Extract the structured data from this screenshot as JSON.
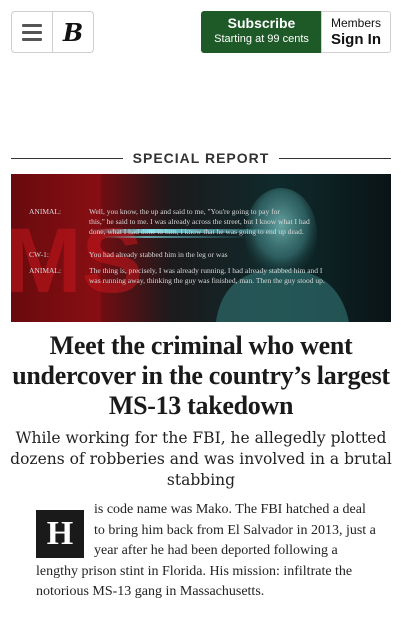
{
  "header": {
    "menu_icon": "hamburger-icon",
    "logo_letter": "B",
    "subscribe_label": "Subscribe",
    "subscribe_sublabel": "Starting at 99 cents",
    "members_label": "Members",
    "signin_label": "Sign In",
    "subscribe_color": "#1e5a27"
  },
  "section": {
    "label": "SPECIAL REPORT"
  },
  "hero": {
    "transcript": [
      {
        "speaker": "ANIMAL:",
        "text": "Well, you know, the          up and said to me, \"You're going to pay for"
      },
      {
        "speaker": "",
        "text": "this,\" he said to me. I was already across the street, but I know what I had"
      },
      {
        "speaker": "",
        "text": "done, what I had done to him, I know that he was going to end up dead."
      },
      {
        "speaker": "CW-1:",
        "text": "You had already stabbed him in the leg or was"
      },
      {
        "speaker": "ANIMAL:",
        "text": "The thing is, precisely, I was already running, I had already stabbed him and I"
      },
      {
        "speaker": "",
        "text": "was running away, thinking the guy was finished, man. Then the guy stood up."
      }
    ],
    "overlay_text": "MS"
  },
  "article": {
    "headline": "Meet the criminal who went undercover in the country’s largest MS-13 takedown",
    "dek": "While working for the FBI, he allegedly plotted dozens of robberies and was involved in a brutal stabbing",
    "dropcap": "H",
    "body": "is code name was Mako. The FBI hatched a deal to bring him back from El Salvador in 2013, just a year after he had been deported following a lengthy prison stint in Florida. His mission: infiltrate the notorious MS-13 gang in Massachusetts."
  }
}
